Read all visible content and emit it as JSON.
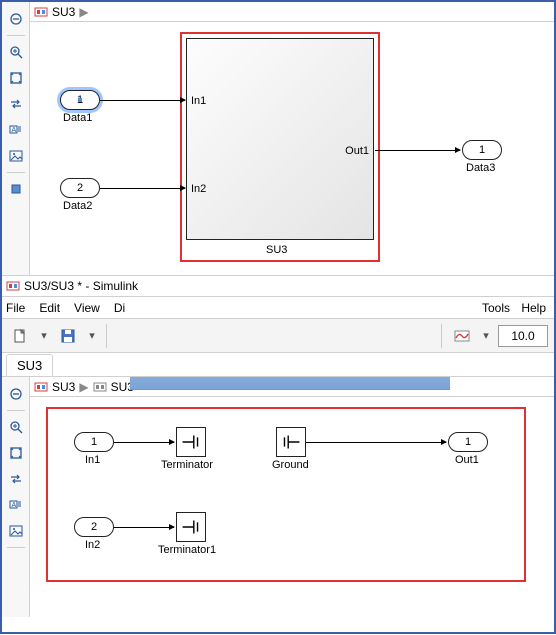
{
  "top": {
    "breadcrumb": {
      "label": "SU3"
    },
    "blocks": {
      "in1": {
        "num": "1",
        "label": "Data1"
      },
      "in2": {
        "num": "2",
        "label": "Data2"
      },
      "out1": {
        "num": "1",
        "label": "Data3"
      },
      "subsystem": {
        "label": "SU3",
        "port_in1": "In1",
        "port_in2": "In2",
        "port_out1": "Out1"
      }
    }
  },
  "bottom": {
    "title": "SU3/SU3 * - Simulink",
    "menus": [
      "File",
      "Edit",
      "View",
      "Di",
      "Tools",
      "Help"
    ],
    "stoptime": "10.0",
    "tab": "SU3",
    "breadcrumb": {
      "root": "SU3",
      "child": "SU3"
    },
    "blocks": {
      "in1": {
        "num": "1",
        "label": "In1"
      },
      "in2": {
        "num": "2",
        "label": "In2"
      },
      "term1": {
        "label": "Terminator"
      },
      "term2": {
        "label": "Terminator1"
      },
      "ground": {
        "label": "Ground"
      },
      "out1": {
        "num": "1",
        "label": "Out1"
      }
    }
  },
  "palette_icons": [
    "hide-icon",
    "zoom-in-icon",
    "fit-icon",
    "swap-icon",
    "annotation-icon",
    "image-icon"
  ]
}
